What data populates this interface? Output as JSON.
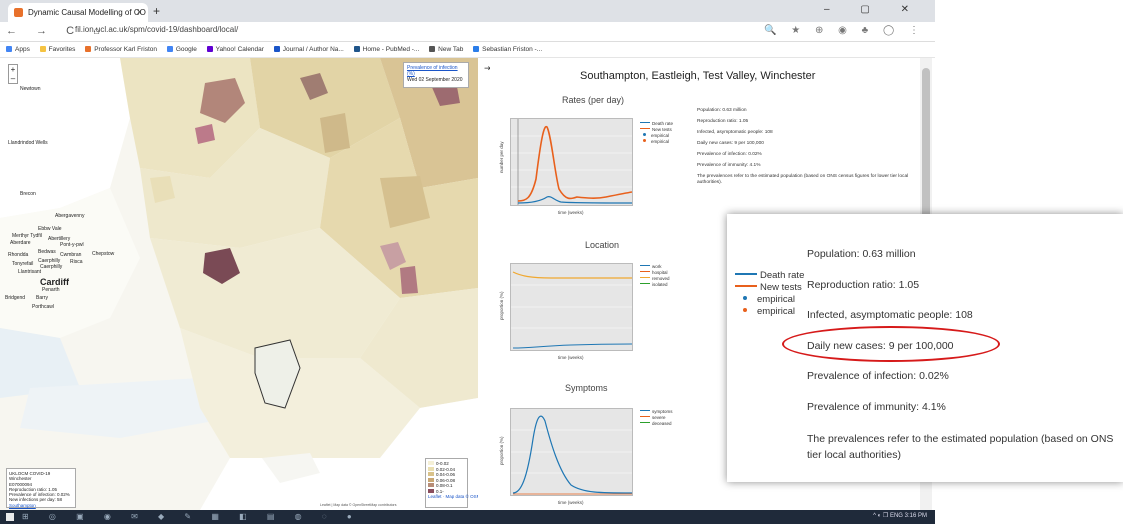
{
  "browser": {
    "tab_title": "Dynamic Causal Modelling of CO",
    "tab_close": "×",
    "new_tab": "+",
    "window_controls": "–  ▢  ✕",
    "nav_icons": "←  →  C  ⌂",
    "url": "fil.ion.ucl.ac.uk/spm/covid-19/dashboard/local/",
    "addr_icons": "🔍 ★ ⊕ ◉ ♣ ◯ ⋮"
  },
  "bookmarks": [
    {
      "label": "Apps",
      "color": "#4285f4"
    },
    {
      "label": "Favorites",
      "color": "#f5c342"
    },
    {
      "label": "Professor Karl Friston",
      "color": "#e8712b"
    },
    {
      "label": "Google",
      "color": "#4285f4"
    },
    {
      "label": "Yahoo! Calendar",
      "color": "#6001d2"
    },
    {
      "label": "Journal / Author Na...",
      "color": "#1a55c8"
    },
    {
      "label": "Home - PubMed -...",
      "color": "#20558a"
    },
    {
      "label": "New Tab",
      "color": "#555555"
    },
    {
      "label": "Sebastian Friston -...",
      "color": "#2b7de9"
    }
  ],
  "map": {
    "zoom_in": "+",
    "zoom_out": "–",
    "places": [
      "Newtown",
      "Llandrindod Wells",
      "Brecon",
      "Abergavenny",
      "Ebbw Vale",
      "Merthyr Tydfil",
      "Aberdare",
      "Abertillery",
      "Pont-y-pwl",
      "Bedwas",
      "Rhondda",
      "Caerphilly",
      "Cwmbran",
      "Tonyrefail",
      "Caerphilly",
      "Llantrisant",
      "Cardiff",
      "Penarth",
      "Barry",
      "Bridgend",
      "Porthcawl",
      "Chepstow",
      "Risca"
    ],
    "tooltip": {
      "title": "Prevalence of infection (%)",
      "date": "Wed 02 September 2020"
    },
    "info": {
      "lines": [
        "UKLOCM COVID-19",
        "Winchester",
        "E07000094",
        "Reproduction ratio: 1.05",
        "Prevalence of infection: 0.02%",
        "New infections per day: 58"
      ],
      "link": "Southampton"
    },
    "legend": {
      "rows": [
        {
          "label": "0-0.02",
          "color": "#f5f0d6"
        },
        {
          "label": "0.02-0.04",
          "color": "#eadfb1"
        },
        {
          "label": "0.04-0.06",
          "color": "#d9c28a"
        },
        {
          "label": "0.06-0.08",
          "color": "#c9a773"
        },
        {
          "label": "0.08-0.1",
          "color": "#b78d77"
        },
        {
          "label": "0.1-",
          "color": "#8a4e5e"
        }
      ],
      "footer": "Leaflet · Map data © OSM"
    },
    "attribution": "Leaflet | Map data © OpenStreetMap contributors"
  },
  "dashboard": {
    "title": "Southampton, Eastleigh, Test Valley, Winchester",
    "exit_icon": "⇥",
    "rates": {
      "heading": "Rates (per day)",
      "ylabel": "number per day",
      "xlabel": "time (weeks)",
      "legend": [
        "Death rate",
        "New tests",
        "empirical",
        "empirical"
      ],
      "yticks": [
        "40",
        "30",
        "20",
        "10",
        "0"
      ],
      "xticks": [
        "0",
        "10",
        "20",
        "30"
      ]
    },
    "location": {
      "heading": "Location",
      "ylabel": "proportion (%)",
      "xlabel": "time (weeks)",
      "legend": [
        "work",
        "hospital",
        "removed",
        "isolated"
      ],
      "xticks": [
        "10",
        "20",
        "30"
      ]
    },
    "symptoms": {
      "heading": "Symptoms",
      "ylabel": "proportion (%)",
      "xlabel": "time (weeks)",
      "legend": [
        "symptoms",
        "severe",
        "deceased"
      ],
      "xticks": [
        "10",
        "20",
        "30"
      ]
    },
    "stats": [
      "Population: 0.63 million",
      "Reproduction ratio: 1.05",
      "Infected, asymptomatic people: 108",
      "Daily new cases: 9 per 100,000",
      "Prevalence of infection: 0.02%",
      "Prevalence of immunity: 4.1%"
    ],
    "note": "The prevalences refer to the estimated population (based on ONS census figures for lower tier local authorities)."
  },
  "zoom": {
    "legend": [
      "Death rate",
      "New tests",
      "empirical",
      "empirical"
    ],
    "stats": [
      "Population: 0.63 million",
      "Reproduction ratio: 1.05",
      "Infected, asymptomatic people: 108",
      "Daily new cases: 9 per 100,000",
      "Prevalence of infection: 0.02%",
      "Prevalence of immunity: 4.1%"
    ],
    "note_line1": "The prevalences refer to the estimated population (based on ONS",
    "note_line2": "tier local authorities)"
  },
  "colors": {
    "death_rate": "#1f77b4",
    "new_tests": "#e8601c",
    "hospital": "#f0a830",
    "highlight": "#d61a1a"
  },
  "taskbar": {
    "apps": "⊞ ◎ ▣ ◉ ✉ ◆ ✎ ▦ ◧ ▤ ◍ ◌ ●",
    "tray": "^  ◐ ❐ ENG  3:16 PM"
  }
}
